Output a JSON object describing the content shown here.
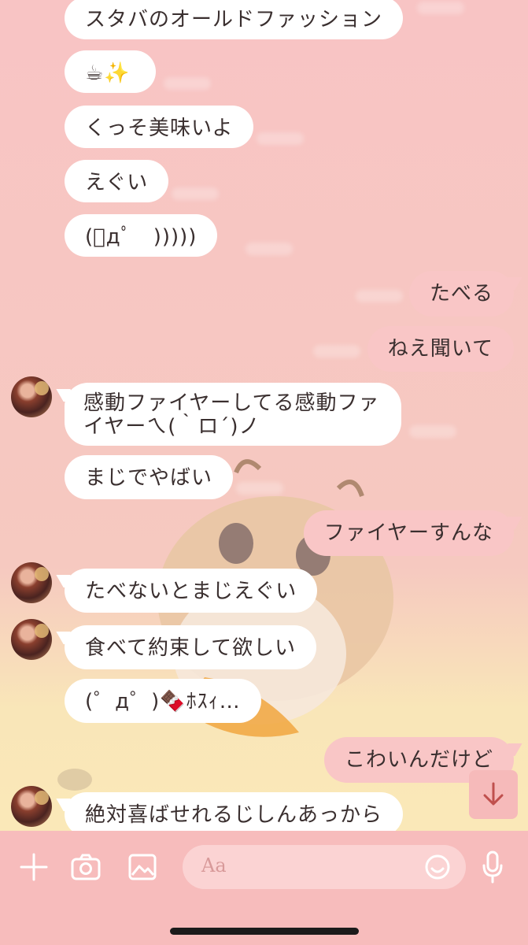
{
  "messages": [
    {
      "text": "スタバのオールドファッション",
      "side": "in"
    },
    {
      "text": "☕✨",
      "side": "in"
    },
    {
      "text": "くっそ美味いよ",
      "side": "in"
    },
    {
      "text": "えぐい",
      "side": "in"
    },
    {
      "text": "(ﾟдﾟ　)))))",
      "side": "in"
    },
    {
      "text": "たべる",
      "side": "out"
    },
    {
      "text": "ねえ聞いて",
      "side": "out"
    },
    {
      "text": "感動ファイヤーしてる感動ファ",
      "text2": "イヤーㄟ(｀ロ´)ノ",
      "side": "in"
    },
    {
      "text": "まじでやばい",
      "side": "in"
    },
    {
      "text": "ファイヤーすんな",
      "side": "out"
    },
    {
      "text": "たべないとまじえぐい",
      "side": "in"
    },
    {
      "text": "食べて約束して欲しい",
      "side": "in"
    },
    {
      "text": "(゜д゜)🍫ﾎｽｨ…",
      "side": "in"
    },
    {
      "text": "こわいんだけど",
      "side": "out"
    },
    {
      "text": "絶対喜ばせれるじしんあっから",
      "side": "in"
    }
  ],
  "composer": {
    "placeholder": "Aa",
    "plus_icon": "plus-icon",
    "camera_icon": "camera-icon",
    "image_icon": "image-icon",
    "emoji_icon": "emoji-icon",
    "mic_icon": "microphone-icon"
  },
  "scroll_down_icon": "arrow-down-icon",
  "colors": {
    "background": "#f7c3c3",
    "outgoing_bubble": "#f9c6c6",
    "incoming_bubble": "#ffffff",
    "text": "#3a2f2f"
  }
}
